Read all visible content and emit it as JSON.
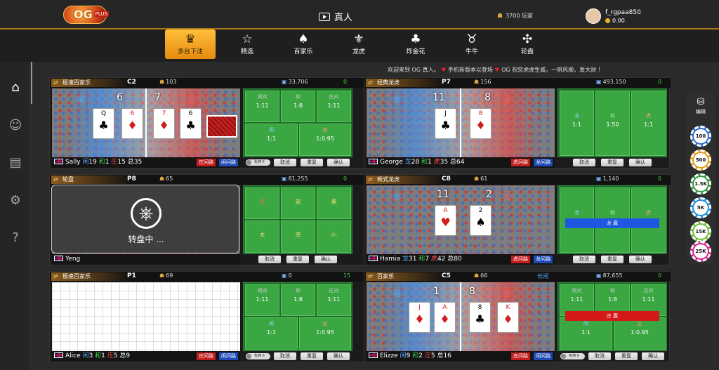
{
  "header": {
    "logo_text": "OG",
    "logo_badge": "PLUS",
    "live_label": "真人",
    "players_label": "3700 玩家",
    "username": "f_rgpaa850",
    "balance": "0.00"
  },
  "nav": [
    {
      "label": "多台下注",
      "icon": "multi-table-icon"
    },
    {
      "label": "精选",
      "icon": "star-icon"
    },
    {
      "label": "百家乐",
      "icon": "cards-icon"
    },
    {
      "label": "龙虎",
      "icon": "dragon-icon"
    },
    {
      "label": "炸金花",
      "icon": "poker-icon"
    },
    {
      "label": "牛牛",
      "icon": "bull-icon"
    },
    {
      "label": "轮盘",
      "icon": "roulette-icon"
    }
  ],
  "marquee": {
    "part1": "欢迎来到 OG 真人。",
    "part2": "手机新版本以登场",
    "part3": "OG 祝您虎虎生威，一帆风顺，发大财 ！"
  },
  "sidebar": {
    "edit_label": "编辑",
    "chips": [
      "100",
      "500",
      "1.5K",
      "5K",
      "15K",
      "25K"
    ]
  },
  "tables": [
    {
      "name": "极速百家乐",
      "code": "C2",
      "players": "103",
      "pool": "33,706",
      "zero": "0",
      "dealer": "Sally",
      "s1": "19",
      "s2": "1",
      "s3": "15",
      "total": "35",
      "stat_b": "闲",
      "stat_g": "和",
      "stat_r": "庄",
      "total_label": "总",
      "left_score": "6",
      "right_score": "7",
      "left_lbl": "闲",
      "right_lbl": "庄",
      "btn1": "庄问路",
      "btn2": "闲问路",
      "bets": [
        [
          "闲对",
          "1:11"
        ],
        [
          "和",
          "1:8"
        ],
        [
          "庄对",
          "1:11"
        ],
        [
          "闲",
          "1:1"
        ],
        [
          "庄",
          "1:0.95"
        ]
      ],
      "free": "免佣 6",
      "cancel": "取消",
      "repeat": "重复",
      "confirm": "确认"
    },
    {
      "name": "经典龙虎",
      "code": "P7",
      "players": "156",
      "pool": "493,150",
      "zero": "0",
      "dealer": "George",
      "s1": "28",
      "s2": "1",
      "s3": "35",
      "total": "64",
      "stat_b": "龙",
      "stat_g": "和",
      "stat_r": "虎",
      "total_label": "总",
      "left_score": "11",
      "right_score": "8",
      "left_lbl": "龙",
      "right_lbl": "虎",
      "btn1": "虎问路",
      "btn2": "龙问路",
      "bets": [
        [
          "龙",
          "1:1"
        ],
        [
          "和",
          "1:50"
        ],
        [
          "虎",
          "1:1"
        ]
      ],
      "cancel": "取消",
      "repeat": "重复",
      "confirm": "确认"
    },
    {
      "name": "轮盘",
      "code": "P8",
      "players": "65",
      "pool": "81,255",
      "zero": "0",
      "dealer": "Yeng",
      "spinning": "转盘中 ...",
      "bets": [
        [
          "红"
        ],
        [
          "双"
        ],
        [
          "黑"
        ],
        [
          "大"
        ],
        [
          "单"
        ],
        [
          "小"
        ]
      ],
      "cancel": "取消",
      "repeat": "重复",
      "confirm": "确认"
    },
    {
      "name": "新式龙虎",
      "code": "C8",
      "players": "61",
      "pool": "1,140",
      "zero": "0",
      "dealer": "Hamia",
      "s1": "31",
      "s2": "7",
      "s3": "42",
      "total": "80",
      "stat_b": "龙",
      "stat_g": "和",
      "stat_r": "虎",
      "total_label": "总",
      "left_score": "11",
      "right_score": "2",
      "left_lbl": "龙",
      "right_lbl": "虎",
      "btn1": "虎问路",
      "btn2": "龙问路",
      "bets": [
        [
          "龙"
        ],
        [
          "和"
        ],
        [
          "虎"
        ]
      ],
      "result": "龙 赢",
      "cancel": "取消",
      "repeat": "重复",
      "confirm": "确认"
    },
    {
      "name": "极速百家乐",
      "code": "P1",
      "players": "69",
      "pool": "0",
      "zero": "15",
      "dealer": "Alice",
      "s1": "3",
      "s2": "1",
      "s3": "5",
      "total": "9",
      "stat_b": "闲",
      "stat_g": "和",
      "stat_r": "庄",
      "total_label": "总",
      "btn1": "庄问路",
      "btn2": "闲问路",
      "bets": [
        [
          "闲对",
          "1:11"
        ],
        [
          "和",
          "1:8"
        ],
        [
          "庄对",
          "1:11"
        ],
        [
          "闲",
          "1:1"
        ],
        [
          "庄",
          "1:0.95"
        ]
      ],
      "free": "免佣 6",
      "cancel": "取消",
      "repeat": "重复",
      "confirm": "确认"
    },
    {
      "name": "百家乐",
      "code": "C5",
      "players": "66",
      "pool": "87,655",
      "zero": "0",
      "long_label": "长闲",
      "dealer": "Elizze",
      "s1": "9",
      "s2": "2",
      "s3": "5",
      "total": "16",
      "stat_b": "闲",
      "stat_g": "和",
      "stat_r": "庄",
      "total_label": "总",
      "left_score": "1",
      "right_score": "8",
      "left_lbl": "闲",
      "right_lbl": "庄",
      "btn1": "庄问路",
      "btn2": "闲问路",
      "bets": [
        [
          "闲对",
          "1:11"
        ],
        [
          "和",
          "1:8"
        ],
        [
          "庄对",
          "1:11"
        ],
        [
          "闲",
          "1:1"
        ],
        [
          "庄",
          "1:0.95"
        ]
      ],
      "result": "庄 赢",
      "free": "免佣 6",
      "cancel": "取消",
      "repeat": "重复",
      "confirm": "确认"
    }
  ],
  "colors": {
    "accent": "#f2a72a",
    "felt": "#3aa742",
    "player": "#5aa7ff",
    "banker": "#ff4a4a"
  }
}
